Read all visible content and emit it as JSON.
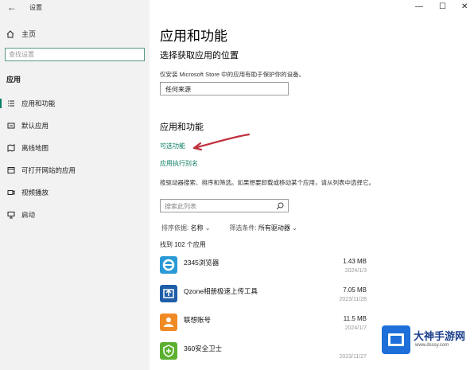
{
  "window": {
    "title": "设置",
    "back_icon": "back-arrow-icon",
    "controls": {
      "minimize": "—",
      "maximize": "☐",
      "close": "✕"
    }
  },
  "sidebar": {
    "home_label": "主页",
    "search_placeholder": "查找设置",
    "section": "应用",
    "items": [
      {
        "label": "应用和功能",
        "icon": "list-icon",
        "active": true
      },
      {
        "label": "默认应用",
        "icon": "default-apps-icon"
      },
      {
        "label": "离线地图",
        "icon": "map-icon"
      },
      {
        "label": "可打开网站的应用",
        "icon": "web-apps-icon"
      },
      {
        "label": "视频播放",
        "icon": "video-icon"
      },
      {
        "label": "启动",
        "icon": "startup-icon"
      }
    ]
  },
  "main": {
    "title": "应用和功能",
    "source_section": {
      "title": "选择获取应用的位置",
      "hint": "仅安装 Microsoft Store 中的应用有助于保护你的设备。",
      "dropdown_value": "任何来源"
    },
    "apps_section": {
      "title": "应用和功能",
      "optional_features_link": "可选功能",
      "aliases_link": "应用执行别名",
      "description": "按驱动器搜索、排序和筛选。如果想要卸载或移动某个应用，请从列表中选择它。",
      "search_placeholder": "搜索此列表",
      "sort_label": "排序依据:",
      "sort_value": "名称",
      "filter_label": "筛选条件:",
      "filter_value": "所有驱动器",
      "count_text": "找到 102 个应用",
      "apps": [
        {
          "name": "2345浏览器",
          "size": "1.43 MB",
          "date": "2024/1/3",
          "color": "#2a9ad6"
        },
        {
          "name": "Qzone相册极速上传工具",
          "size": "7.05 MB",
          "date": "2023/11/28",
          "color": "#1f5ea8"
        },
        {
          "name": "联想账号",
          "size": "11.5 MB",
          "date": "2024/1/7",
          "color": "#f08a24"
        },
        {
          "name": "360安全卫士",
          "size": "",
          "date": "2023/11/27",
          "color": "#5bb030"
        }
      ]
    }
  },
  "watermark": {
    "text": "大神手游网",
    "url": "www.dsssy.com"
  }
}
